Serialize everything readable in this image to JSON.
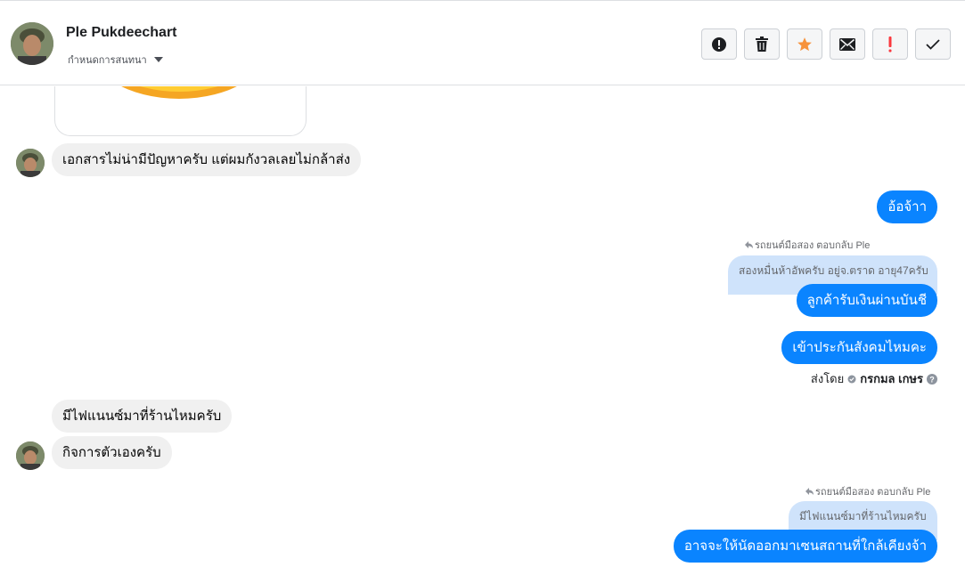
{
  "header": {
    "name": "Ple Pukdeechart",
    "subtitle": "กำหนดการสนทนา",
    "toolbar": {
      "spam_icon": "alert-circle-icon",
      "delete_icon": "trash-icon",
      "star_icon": "star-icon",
      "unread_icon": "envelope-icon",
      "important_icon": "exclamation-icon",
      "done_icon": "checkmark-icon",
      "star_color": "#f7923b",
      "important_color": "#fa383e"
    }
  },
  "messages": {
    "m1": "เอกสารไม่น่ามีปัญหาครับ แต่ผมกังวลเลยไม่กล้าส่ง",
    "m2": "อ้อจ้าา",
    "reply1_label": "รถยนต์มือสอง ตอบกลับ Ple",
    "reply1_quote": "สองหมื่นห้าอัพครับ อยู่จ.ตราด อายุ47ครับ",
    "m3": "ลูกค้ารับเงินผ่านบันชี",
    "m4": "เข้าประกันสังคมไหมคะ",
    "sent_by_prefix": "ส่งโดย",
    "sent_by_agent": "กรกมล เกษร",
    "m5": "มีไฟแนนซ์มาที่ร้านไหมครับ",
    "m6": "กิจการตัวเองครับ",
    "reply2_label": "รถยนต์มือสอง ตอบกลับ Ple",
    "reply2_quote": "มีไฟแนนซ์มาที่ร้านไหมครับ",
    "m7": "อาจจะให้นัดออกมาเซนสถานที่ใกล้เคียงจ้า"
  },
  "colors": {
    "outgoing": "#0a84ff",
    "incoming": "#f0f0f0",
    "quote": "#cfe3fb"
  }
}
